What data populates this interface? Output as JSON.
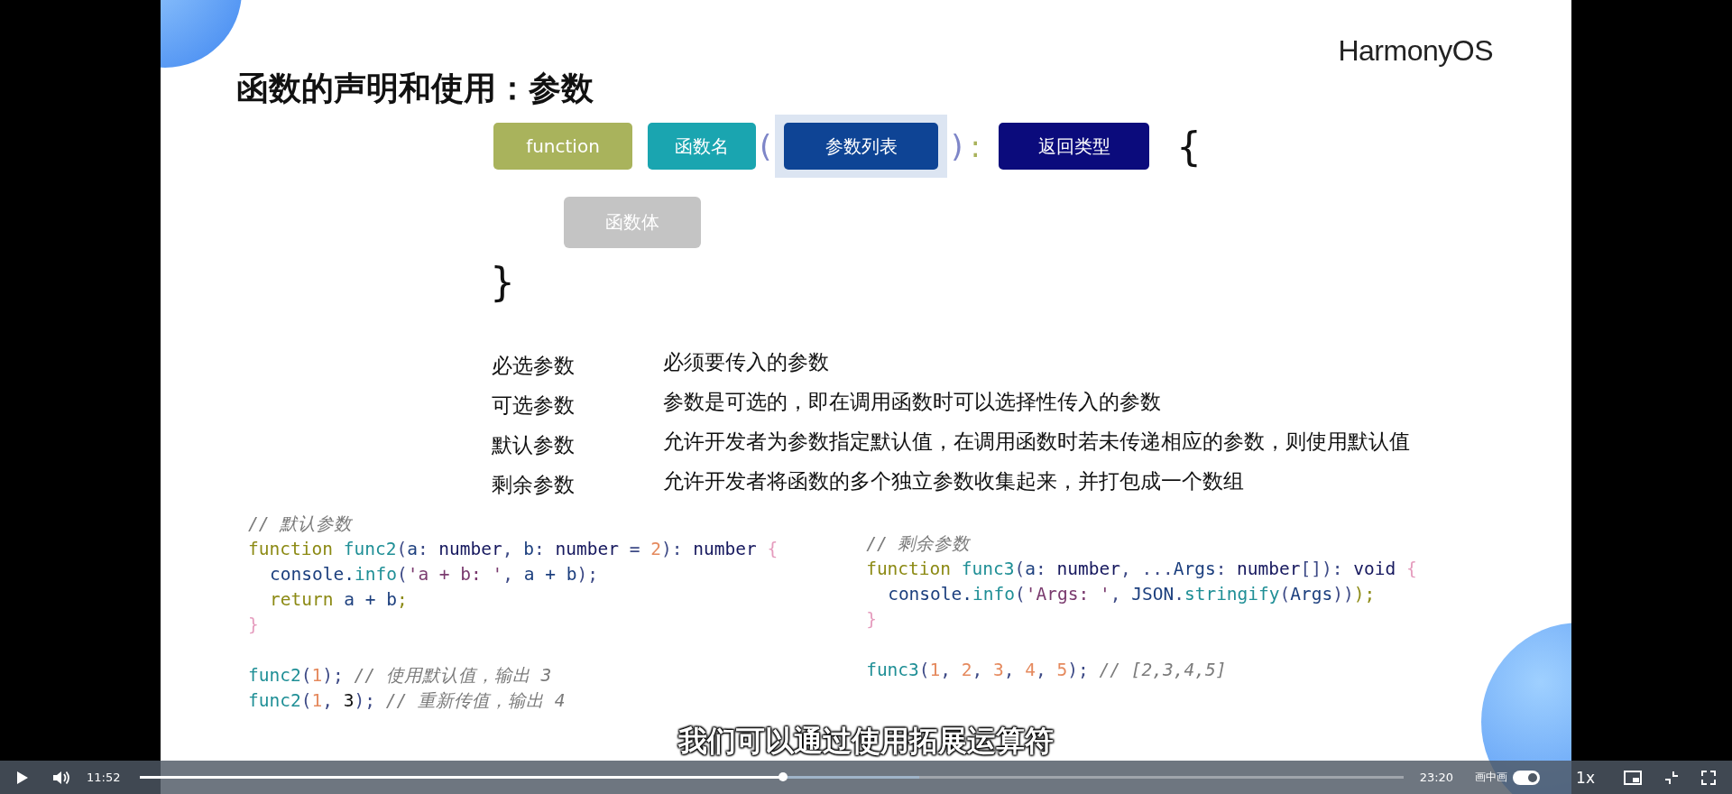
{
  "slide": {
    "logo": "HarmonyOS",
    "title": "函数的声明和使用：参数",
    "signature": [
      {
        "kind": "box",
        "text": "function",
        "color": "#a9b35c",
        "highlighted": false
      },
      {
        "kind": "box",
        "text": "函数名",
        "color": "#1aa5b0",
        "highlighted": false
      },
      {
        "kind": "mark",
        "text": "("
      },
      {
        "kind": "box",
        "text": "参数列表",
        "color": "#0e4495",
        "highlighted": true
      },
      {
        "kind": "mark",
        "text": ")"
      },
      {
        "kind": "mark",
        "text": ":"
      },
      {
        "kind": "box",
        "text": "返回类型",
        "color": "#0b0b7c",
        "highlighted": false
      },
      {
        "kind": "brace",
        "text": "{"
      }
    ],
    "body_box": {
      "text": "函数体",
      "color": "#c4c4c4"
    },
    "closing_brace": "}",
    "param_types": [
      {
        "term": "必选参数",
        "description": "必须要传入的参数"
      },
      {
        "term": "可选参数",
        "description": "参数是可选的，即在调用函数时可以选择性传入的参数"
      },
      {
        "term": "默认参数",
        "description": "允许开发者为参数指定默认值，在调用函数时若未传递相应的参数，则使用默认值"
      },
      {
        "term": "剩余参数",
        "description": "允许开发者将函数的多个独立参数收集起来，并打包成一个数组"
      }
    ],
    "code_blocks": [
      {
        "groups": [
          [
            {
              "indent": false,
              "tokens": [
                {
                  "kind": "comment",
                  "text": "// 默认参数"
                }
              ]
            },
            {
              "indent": false,
              "tokens": [
                {
                  "kind": "keyword",
                  "text": "function "
                },
                {
                  "kind": "func",
                  "text": "func2"
                },
                {
                  "kind": "punct",
                  "text": "("
                },
                {
                  "kind": "var",
                  "text": "a"
                },
                {
                  "kind": "punct",
                  "text": ": "
                },
                {
                  "kind": "type",
                  "text": "number"
                },
                {
                  "kind": "punct",
                  "text": ", "
                },
                {
                  "kind": "var",
                  "text": "b"
                },
                {
                  "kind": "punct",
                  "text": ": "
                },
                {
                  "kind": "type",
                  "text": "number"
                },
                {
                  "kind": "punct",
                  "text": " = "
                },
                {
                  "kind": "number",
                  "text": "2"
                },
                {
                  "kind": "punct",
                  "text": "): "
                },
                {
                  "kind": "type",
                  "text": "number "
                },
                {
                  "kind": "brace",
                  "text": "{"
                }
              ]
            },
            {
              "indent": true,
              "tokens": [
                {
                  "kind": "var",
                  "text": "console."
                },
                {
                  "kind": "func",
                  "text": "info"
                },
                {
                  "kind": "punct",
                  "text": "("
                },
                {
                  "kind": "string",
                  "text": "'a + b: '"
                },
                {
                  "kind": "punct",
                  "text": ", "
                },
                {
                  "kind": "var",
                  "text": "a + b"
                },
                {
                  "kind": "punct",
                  "text": ");"
                }
              ]
            },
            {
              "indent": true,
              "tokens": [
                {
                  "kind": "keyword",
                  "text": "return "
                },
                {
                  "kind": "var",
                  "text": "a + b"
                },
                {
                  "kind": "keyword",
                  "text": ";"
                }
              ]
            },
            {
              "indent": false,
              "tokens": [
                {
                  "kind": "brace",
                  "text": "}"
                }
              ]
            }
          ],
          [
            {
              "indent": false,
              "tokens": [
                {
                  "kind": "func",
                  "text": "func2"
                },
                {
                  "kind": "punct",
                  "text": "("
                },
                {
                  "kind": "number",
                  "text": "1"
                },
                {
                  "kind": "punct",
                  "text": "); "
                },
                {
                  "kind": "comment",
                  "text": "// 使用默认值，输出 3"
                }
              ]
            },
            {
              "indent": false,
              "tokens": [
                {
                  "kind": "func",
                  "text": "func2"
                },
                {
                  "kind": "punct",
                  "text": "("
                },
                {
                  "kind": "number",
                  "text": "1"
                },
                {
                  "kind": "punct",
                  "text": ", "
                },
                {
                  "kind": "plain",
                  "text": "3"
                },
                {
                  "kind": "punct",
                  "text": "); "
                },
                {
                  "kind": "comment",
                  "text": "// 重新传值，输出 4"
                }
              ]
            }
          ]
        ]
      },
      {
        "groups": [
          [
            {
              "indent": false,
              "tokens": [
                {
                  "kind": "comment",
                  "text": "// 剩余参数"
                }
              ]
            },
            {
              "indent": false,
              "tokens": [
                {
                  "kind": "keyword",
                  "text": "function "
                },
                {
                  "kind": "func",
                  "text": "func3"
                },
                {
                  "kind": "punct",
                  "text": "("
                },
                {
                  "kind": "var",
                  "text": "a"
                },
                {
                  "kind": "punct",
                  "text": ": "
                },
                {
                  "kind": "type",
                  "text": "number"
                },
                {
                  "kind": "punct",
                  "text": ", ..."
                },
                {
                  "kind": "var",
                  "text": "Args"
                },
                {
                  "kind": "punct",
                  "text": ": "
                },
                {
                  "kind": "type",
                  "text": "number"
                },
                {
                  "kind": "punct",
                  "text": "[]): "
                },
                {
                  "kind": "type",
                  "text": "void "
                },
                {
                  "kind": "brace",
                  "text": "{"
                }
              ]
            },
            {
              "indent": true,
              "tokens": [
                {
                  "kind": "var",
                  "text": "console."
                },
                {
                  "kind": "func",
                  "text": "info"
                },
                {
                  "kind": "punct",
                  "text": "("
                },
                {
                  "kind": "string",
                  "text": "'Args: '"
                },
                {
                  "kind": "punct",
                  "text": ", "
                },
                {
                  "kind": "var",
                  "text": "JSON"
                },
                {
                  "kind": "punct",
                  "text": "."
                },
                {
                  "kind": "func",
                  "text": "stringify"
                },
                {
                  "kind": "punct",
                  "text": "("
                },
                {
                  "kind": "var",
                  "text": "Args"
                },
                {
                  "kind": "punct",
                  "text": "))"
                },
                {
                  "kind": "keyword",
                  "text": ");"
                }
              ]
            },
            {
              "indent": false,
              "tokens": [
                {
                  "kind": "brace",
                  "text": "}"
                }
              ]
            }
          ],
          [
            {
              "indent": false,
              "tokens": [
                {
                  "kind": "func",
                  "text": "func3"
                },
                {
                  "kind": "punct",
                  "text": "("
                },
                {
                  "kind": "number",
                  "text": "1"
                },
                {
                  "kind": "punct",
                  "text": ", "
                },
                {
                  "kind": "number",
                  "text": "2"
                },
                {
                  "kind": "punct",
                  "text": ", "
                },
                {
                  "kind": "number",
                  "text": "3"
                },
                {
                  "kind": "punct",
                  "text": ", "
                },
                {
                  "kind": "number",
                  "text": "4"
                },
                {
                  "kind": "punct",
                  "text": ", "
                },
                {
                  "kind": "number",
                  "text": "5"
                },
                {
                  "kind": "punct",
                  "text": "); "
                },
                {
                  "kind": "comment",
                  "text": "// [2,3,4,5]"
                }
              ]
            }
          ]
        ]
      }
    ]
  },
  "subtitle": "我们可以通过使用拓展运算符",
  "player": {
    "current_time": "11:52",
    "progress": {
      "level": 0.509
    },
    "buffer": {
      "level": 0.617
    },
    "duration": "23:20",
    "pip_label": "画中画",
    "pip_toggle": {
      "on": true
    },
    "speed": "1x"
  }
}
